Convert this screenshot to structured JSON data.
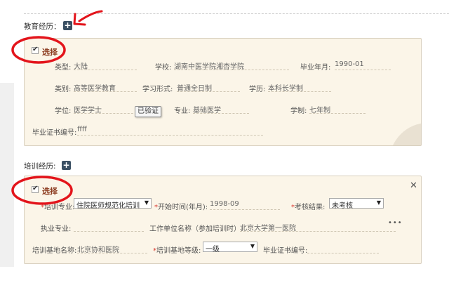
{
  "education": {
    "section_label": "教育经历：",
    "add_icon": "plus-icon",
    "select_label": "选择",
    "type_label": "类型:",
    "type_value": "大陆",
    "school_label": "学校:",
    "school_value": "湖南中医学院湘杏学院",
    "grad_year_label": "毕业年月:",
    "grad_year_value": "1990-01",
    "category_label": "类别:",
    "category_value": "高等医学教育",
    "study_form_label": "学习形式:",
    "study_form_value": "普通全日制",
    "education_label": "学历:",
    "education_value": "本科长学制",
    "degree_label": "学位:",
    "degree_value": "医学学士",
    "verified_badge": "已验证",
    "major_label": "专业:",
    "major_value": "基础医学",
    "duration_label": "学制:",
    "duration_value": "七年制",
    "cert_label": "毕业证书编号:",
    "cert_value": "ffff"
  },
  "training": {
    "section_label": "培训经历:",
    "add_icon": "plus-icon",
    "select_label": "选择",
    "close_icon": "close-icon",
    "program_label": "培训专业:",
    "program_value": "住院医师规范化培训",
    "start_label": "开始时间(年月):",
    "start_value": "1998-09",
    "result_label": "考核结果:",
    "result_value": "未考核",
    "practice_label": "执业专业:",
    "practice_value": "",
    "unit_label": "工作单位名称（参加培训时）:",
    "unit_value": "北京大学第一医院",
    "unit_more": "•••",
    "base_label": "培训基地名称:",
    "base_value": "北京协和医院",
    "base_level_label": "培训基地等级:",
    "base_level_value": "一级",
    "cert_label": "毕业证书编号:",
    "cert_value": ""
  },
  "annotations": {
    "circle_color": "#e3141b",
    "arrow_color": "#e3141b"
  }
}
